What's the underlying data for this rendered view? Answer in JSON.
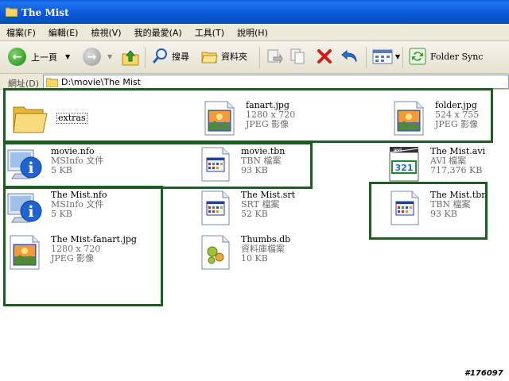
{
  "window": {
    "title": "The Mist"
  },
  "menu": [
    "檔案(F)",
    "編輯(E)",
    "檢視(V)",
    "我的最愛(A)",
    "工具(T)",
    "說明(H)"
  ],
  "toolbar": {
    "back_label": "上一頁",
    "search_label": "搜尋",
    "folders_label": "資料夾",
    "foldersync_label": "Folder Sync"
  },
  "address": {
    "label": "網址(D)",
    "path": "D:\\movie\\The Mist"
  },
  "files": [
    {
      "id": "extras",
      "name": "extras",
      "icon": "folder-icon"
    },
    {
      "id": "fanart",
      "name": "fanart.jpg",
      "info": "1280 x 720",
      "type": "JPEG 影像",
      "icon": "jpeg-image-icon"
    },
    {
      "id": "folderjpg",
      "name": "folder.jpg",
      "info": "524 x 755",
      "type": "JPEG 影像",
      "icon": "jpeg-image-icon"
    },
    {
      "id": "movienfo",
      "name": "movie.nfo",
      "info": "MSInfo 文件",
      "type": "5 KB",
      "icon": "msinfo-icon"
    },
    {
      "id": "movietbn",
      "name": "movie.tbn",
      "info": "TBN 檔案",
      "type": "93 KB",
      "icon": "tbn-file-icon"
    },
    {
      "id": "mistavi",
      "name": "The Mist.avi",
      "info": "AVI 檔案",
      "type": "717,376 KB",
      "icon": "avi-file-icon"
    },
    {
      "id": "mistnfo",
      "name": "The Mist.nfo",
      "info": "MSInfo 文件",
      "type": "5 KB",
      "icon": "msinfo-icon"
    },
    {
      "id": "mistsrt",
      "name": "The Mist.srt",
      "info": "SRT 檔案",
      "type": "52 KB",
      "icon": "srt-file-icon"
    },
    {
      "id": "misttbn",
      "name": "The Mist.tbn",
      "info": "TBN 檔案",
      "type": "93 KB",
      "icon": "tbn-file-icon"
    },
    {
      "id": "mistfanart",
      "name": "The Mist-fanart.jpg",
      "info": "1280 x 720",
      "type": "JPEG 影像",
      "icon": "jpeg-image-icon"
    },
    {
      "id": "thumbs",
      "name": "Thumbs.db",
      "info": "資料庫檔案",
      "type": "10 KB",
      "icon": "database-file-icon"
    }
  ],
  "watermark": "#176097",
  "colors": {
    "titlebar": "#0b5bd8",
    "highlight_box": "#1b5e20"
  }
}
